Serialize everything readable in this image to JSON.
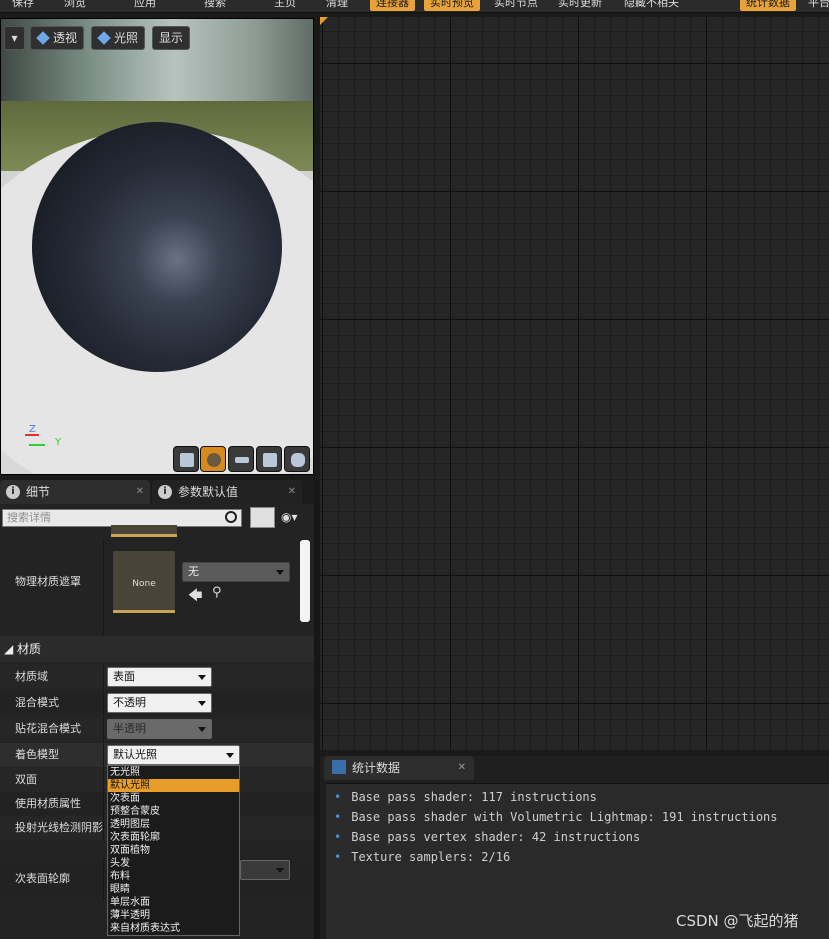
{
  "toolbar": {
    "items": [
      "保存",
      "浏览",
      "应用",
      "搜索",
      "主页",
      "清理",
      "连接器",
      "实时预览",
      "实时节点",
      "实时更新",
      "隐藏不相关",
      "统计数据",
      "平台"
    ]
  },
  "viewport": {
    "buttons": {
      "perspective": "透视",
      "lit": "光照",
      "show": "显示"
    },
    "axis": {
      "z": "Z",
      "y": "Y"
    }
  },
  "details": {
    "tabs": {
      "details": "细节",
      "param_defaults": "参数默认值"
    },
    "search_placeholder": "搜索详情",
    "phys_mat_mask_label": "物理材质遮罩",
    "thumb_label": "None",
    "phys_mat_mask_value": "无",
    "section_material": "材质",
    "rows": {
      "material_domain": {
        "label": "材质域",
        "value": "表面"
      },
      "blend_mode": {
        "label": "混合模式",
        "value": "不透明"
      },
      "decal_blend_mode": {
        "label": "贴花混合模式",
        "value": "半透明"
      },
      "shading_model": {
        "label": "着色模型",
        "value": "默认光照"
      },
      "two_sided": {
        "label": "双面"
      },
      "use_material_attributes": {
        "label": "使用材质属性"
      },
      "cast_ray_traced_shadows": {
        "label": "投射光线检测阴影"
      },
      "subsurface_profile": {
        "label": "次表面轮廓"
      }
    },
    "shading_model_options": [
      "无光照",
      "默认光照",
      "次表面",
      "预整合蒙皮",
      "透明图层",
      "次表面轮廓",
      "双面植物",
      "头发",
      "布料",
      "眼睛",
      "单层水面",
      "薄半透明",
      "来自材质表达式"
    ]
  },
  "stats": {
    "tab_label": "统计数据",
    "lines": [
      "Base pass shader: 117 instructions",
      "Base pass shader with Volumetric Lightmap: 191 instructions",
      "Base pass vertex shader: 42 instructions",
      "Texture samplers: 2/16"
    ]
  },
  "watermark": "CSDN @飞起的猪",
  "colors": {
    "accent": "#e89d2a",
    "graph_bg": "#262626"
  }
}
